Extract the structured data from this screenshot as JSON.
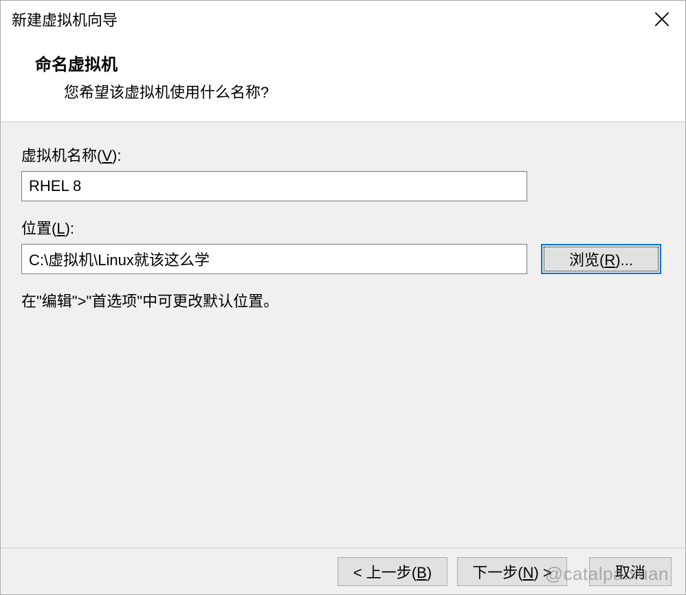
{
  "titlebar": {
    "title": "新建虚拟机向导"
  },
  "header": {
    "title": "命名虚拟机",
    "subtitle": "您希望该虚拟机使用什么名称?"
  },
  "fields": {
    "vmname": {
      "label_pre": "虚拟机名称(",
      "label_key": "V",
      "label_post": "):",
      "value": "RHEL 8"
    },
    "location": {
      "label_pre": "位置(",
      "label_key": "L",
      "label_post": "):",
      "value": "C:\\虚拟机\\Linux就该这么学",
      "browse_pre": "浏览(",
      "browse_key": "R",
      "browse_post": ")..."
    },
    "hint": "在\"编辑\">\"首选项\"中可更改默认位置。"
  },
  "footer": {
    "back_pre": "< 上一步(",
    "back_key": "B",
    "back_post": ")",
    "next_pre": "下一步(",
    "next_key": "N",
    "next_post": ") >",
    "cancel": "取消"
  },
  "watermark": "@catalpa.xuan"
}
